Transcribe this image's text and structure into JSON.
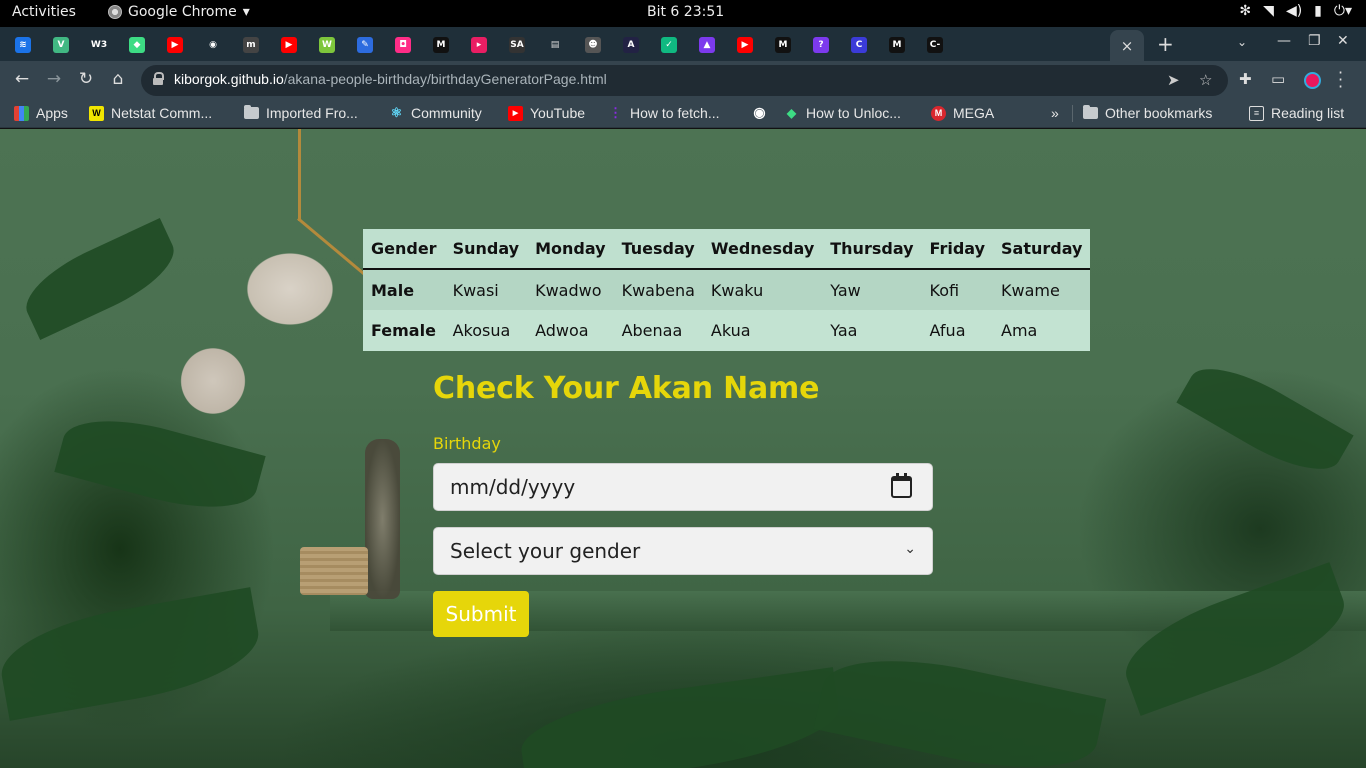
{
  "system_bar": {
    "activities": "Activities",
    "app_name": "Google Chrome",
    "clock": "Bit 6  23:51"
  },
  "browser": {
    "tab_close": "×",
    "new_tab": "+",
    "url_host": "kiborgok.github.io",
    "url_path": "/akana-people-birthday/birthdayGeneratorPage.html",
    "tab_favicons": [
      {
        "icon": "tab-favicon-wave",
        "color": "#1b73e8",
        "glyph": "≋"
      },
      {
        "icon": "tab-favicon-vue",
        "color": "#41b883",
        "glyph": "V"
      },
      {
        "icon": "tab-favicon-w3",
        "color": "#ffffff",
        "glyph": "W3"
      },
      {
        "icon": "tab-favicon-android",
        "color": "#3ddc84",
        "glyph": "◆"
      },
      {
        "icon": "tab-favicon-youtube",
        "color": "#ff0000",
        "glyph": "▶"
      },
      {
        "icon": "tab-favicon-globe",
        "color": "#ffffff",
        "glyph": "◉"
      },
      {
        "icon": "tab-favicon-mbg",
        "color": "#444444",
        "glyph": "m"
      },
      {
        "icon": "tab-favicon-youtube",
        "color": "#ff0000",
        "glyph": "▶"
      },
      {
        "icon": "tab-favicon-webflow",
        "color": "#7ec63c",
        "glyph": "W"
      },
      {
        "icon": "tab-favicon-docs",
        "color": "#2d6cdf",
        "glyph": "✎"
      },
      {
        "icon": "tab-favicon-pink",
        "color": "#ff2d87",
        "glyph": "◘"
      },
      {
        "icon": "tab-favicon-medium",
        "color": "#111111",
        "glyph": "M"
      },
      {
        "icon": "tab-favicon-play",
        "color": "#e91e63",
        "glyph": "▸"
      },
      {
        "icon": "tab-favicon-sa",
        "color": "#333333",
        "glyph": "SA"
      },
      {
        "icon": "tab-favicon-notes",
        "color": "#dddddd",
        "glyph": "▤"
      },
      {
        "icon": "tab-favicon-avatar",
        "color": "#555555",
        "glyph": "☻"
      },
      {
        "icon": "tab-favicon-react",
        "color": "#222244",
        "glyph": "A"
      },
      {
        "icon": "tab-favicon-green",
        "color": "#10b981",
        "glyph": "✓"
      },
      {
        "icon": "tab-favicon-rocket",
        "color": "#7c3aed",
        "glyph": "▲"
      },
      {
        "icon": "tab-favicon-youtube",
        "color": "#ff0000",
        "glyph": "▶"
      },
      {
        "icon": "tab-favicon-medium",
        "color": "#111111",
        "glyph": "M"
      },
      {
        "icon": "tab-favicon-question",
        "color": "#7c3aed",
        "glyph": "?"
      },
      {
        "icon": "tab-favicon-c",
        "color": "#3b3bd8",
        "glyph": "C"
      },
      {
        "icon": "tab-favicon-medium",
        "color": "#111111",
        "glyph": "M"
      },
      {
        "icon": "tab-favicon-c-dash",
        "color": "#111111",
        "glyph": "C-"
      }
    ]
  },
  "bookmarks": [
    {
      "label": "Apps",
      "icon": "apps-grid-icon",
      "color": "#e34133"
    },
    {
      "label": "Netstat Comm...",
      "icon": "netstat-favicon",
      "color": "#f2e600"
    },
    {
      "label": "Imported Fro...",
      "icon": "folder-icon",
      "color": ""
    },
    {
      "label": "Community",
      "icon": "react-favicon",
      "color": "#61dafb"
    },
    {
      "label": "YouTube",
      "icon": "youtube-favicon",
      "color": "#ff0000"
    },
    {
      "label": "How to fetch...",
      "icon": "dots-favicon",
      "color": "#8a2be2"
    },
    {
      "label": "",
      "icon": "globe-favicon",
      "color": "#ffffff"
    },
    {
      "label": "How to Unloc...",
      "icon": "android-favicon",
      "color": "#3ddc84"
    },
    {
      "label": "MEGA",
      "icon": "mega-favicon",
      "color": "#d9272e"
    },
    {
      "label": "»",
      "icon": "more-bookmarks-icon",
      "color": ""
    },
    {
      "label": "Other bookmarks",
      "icon": "folder-icon",
      "color": ""
    },
    {
      "label": "Reading list",
      "icon": "reading-list-icon",
      "color": ""
    }
  ],
  "table": {
    "headers": [
      "Gender",
      "Sunday",
      "Monday",
      "Tuesday",
      "Wednesday",
      "Thursday",
      "Friday",
      "Saturday"
    ],
    "rows": [
      [
        "Male",
        "Kwasi",
        "Kwadwo",
        "Kwabena",
        "Kwaku",
        "Yaw",
        "Kofi",
        "Kwame"
      ],
      [
        "Female",
        "Akosua",
        "Adwoa",
        "Abenaa",
        "Akua",
        "Yaa",
        "Afua",
        "Ama"
      ]
    ]
  },
  "form": {
    "title": "Check Your Akan Name",
    "birthday_label": "Birthday",
    "date_placeholder": "mm/dd/yyyy",
    "gender_placeholder": "Select your gender",
    "submit_label": "Submit"
  },
  "colors": {
    "accent_yellow": "#e6d60a",
    "table_header_bg": "#bfe0cf",
    "chrome_frame": "#35444e"
  }
}
